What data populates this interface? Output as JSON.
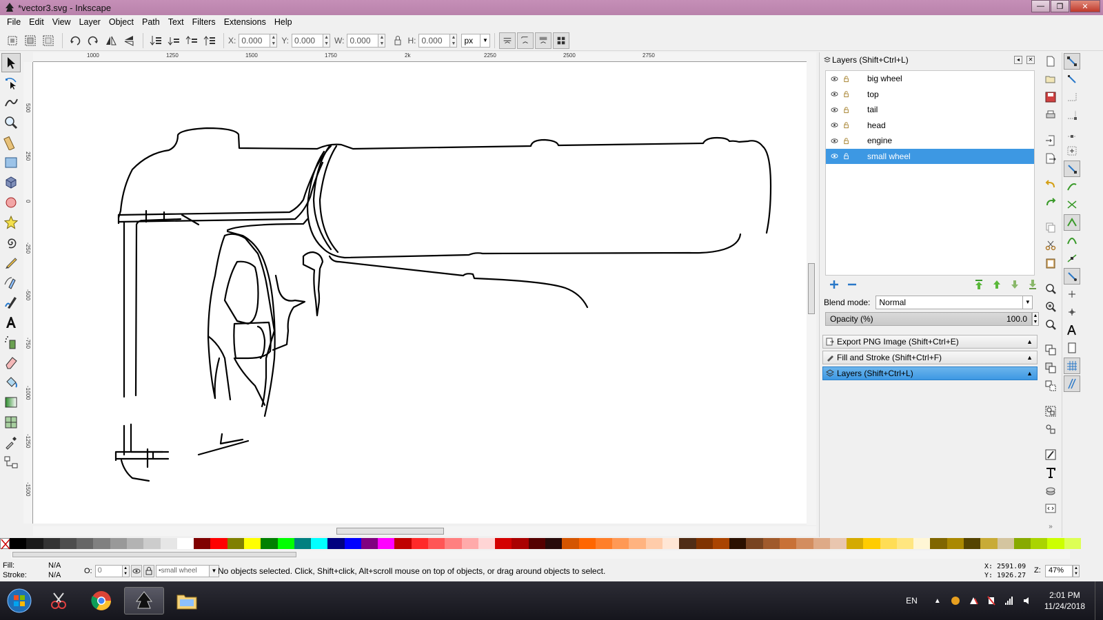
{
  "window": {
    "title": "*vector3.svg - Inkscape",
    "minimize_label": "—",
    "maximize_label": "❐",
    "close_label": "✕"
  },
  "menu": [
    "File",
    "Edit",
    "View",
    "Layer",
    "Object",
    "Path",
    "Text",
    "Filters",
    "Extensions",
    "Help"
  ],
  "controls": {
    "x_label": "X:",
    "x_value": "0.000",
    "y_label": "Y:",
    "y_value": "0.000",
    "w_label": "W:",
    "w_value": "0.000",
    "h_label": "H:",
    "h_value": "0.000",
    "unit": "px"
  },
  "ruler": {
    "h_labels": [
      "1000",
      "1250",
      "1500",
      "1750",
      "2k",
      "2250",
      "2500",
      "2750"
    ],
    "v_labels": [
      "500",
      "250",
      "0",
      "-250",
      "-500",
      "-750",
      "-1000",
      "-1250",
      "-1500"
    ]
  },
  "layers_panel": {
    "title": "Layers (Shift+Ctrl+L)",
    "layers": [
      {
        "name": "big wheel",
        "selected": false
      },
      {
        "name": "top",
        "selected": false
      },
      {
        "name": "tail",
        "selected": false
      },
      {
        "name": "head",
        "selected": false
      },
      {
        "name": "engine",
        "selected": false
      },
      {
        "name": "small wheel",
        "selected": true
      }
    ],
    "blend_label": "Blend mode:",
    "blend_value": "Normal",
    "opacity_label": "Opacity (%)",
    "opacity_value": "100.0"
  },
  "dock_tabs": [
    {
      "label": "Export PNG Image (Shift+Ctrl+E)",
      "active": false
    },
    {
      "label": "Fill and Stroke (Shift+Ctrl+F)",
      "active": false
    },
    {
      "label": "Layers (Shift+Ctrl+L)",
      "active": true
    }
  ],
  "palette": [
    "#000000",
    "#1a1a1a",
    "#333333",
    "#4d4d4d",
    "#666666",
    "#808080",
    "#999999",
    "#b3b3b3",
    "#cccccc",
    "#e6e6e6",
    "#ffffff",
    "#800000",
    "#ff0000",
    "#808000",
    "#ffff00",
    "#008000",
    "#00ff00",
    "#008080",
    "#00ffff",
    "#000080",
    "#0000ff",
    "#800080",
    "#ff00ff",
    "#c00000",
    "#ff2a2a",
    "#ff5555",
    "#ff8080",
    "#ffaaaa",
    "#ffd5d5",
    "#d40000",
    "#aa0000",
    "#550000",
    "#280b0b",
    "#d45500",
    "#ff6600",
    "#ff7f2a",
    "#ff9955",
    "#ffb380",
    "#ffccaa",
    "#ffe6d5",
    "#502d16",
    "#803300",
    "#aa4400",
    "#2b1100",
    "#784421",
    "#a05a2c",
    "#c87137",
    "#d38d5f",
    "#deaa87",
    "#e9c6af",
    "#d4aa00",
    "#ffcc00",
    "#ffdd55",
    "#ffe680",
    "#fff6d5",
    "#806600",
    "#aa8800",
    "#554400",
    "#c8ab37",
    "#d4c5a0",
    "#88aa00",
    "#aad400",
    "#ccff00",
    "#ddff55"
  ],
  "status": {
    "fill_label": "Fill:",
    "fill_value": "N/A",
    "stroke_label": "Stroke:",
    "stroke_value": "N/A",
    "opacity_label": "O:",
    "opacity_value": "0",
    "current_layer": "•small wheel",
    "message": "No objects selected. Click, Shift+click, Alt+scroll mouse on top of objects, or drag around objects to select.",
    "cursor_x": "X: 2591.09",
    "cursor_y": "Y: 1926.27",
    "zoom_label": "Z:",
    "zoom_value": "47%"
  },
  "taskbar": {
    "language": "EN",
    "time": "2:01 PM",
    "date": "11/24/2018"
  }
}
